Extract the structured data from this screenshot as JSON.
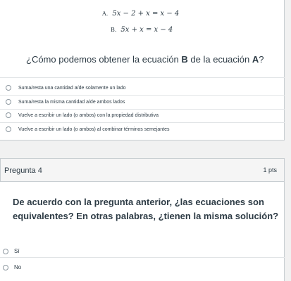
{
  "question3": {
    "equations": [
      {
        "label": "A.",
        "expr": "5x − 2 + x = x − 4"
      },
      {
        "label": "B.",
        "expr": "5x + x = x − 4"
      }
    ],
    "prompt_pre": "¿Cómo podemos obtener la ecuación ",
    "prompt_bold_b": "B",
    "prompt_mid": " de la ecuación ",
    "prompt_bold_a": "A",
    "prompt_post": "?",
    "options": [
      "Suma/resta una cantidad a/de solamente un lado",
      "Suma/resta la misma cantidad a/de ambos lados",
      "Vuelve a escribir un lado (o ambos) con la propiedad distributiva",
      "Vuelve a escribir un lado (o ambos) al combinar términos semejantes"
    ]
  },
  "question4": {
    "title": "Pregunta 4",
    "points": "1 pts",
    "prompt": "De acuerdo con la pregunta anterior, ¿las ecuaciones son equivalentes? En otras palabras, ¿tienen la misma solución?",
    "options": [
      "Sí",
      "No"
    ]
  }
}
